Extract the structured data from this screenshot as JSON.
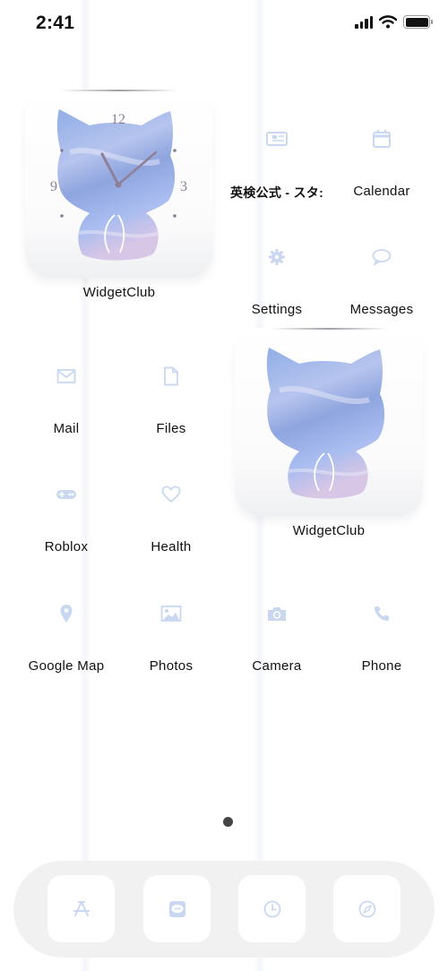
{
  "status_bar": {
    "time": "2:41",
    "signal_icon": "cellular-signal-icon",
    "wifi_icon": "wifi-icon",
    "battery_icon": "battery-full-icon"
  },
  "colors": {
    "icon_tint": "#c9d8f0",
    "label": "#111111",
    "dock_bg": "#f1f1f2",
    "page_dot_active": "#444444"
  },
  "widgets": [
    {
      "label": "WidgetClub",
      "type": "clock",
      "icon": "cat-sky-clock-icon",
      "clock_numerals": [
        "12",
        "3",
        "9"
      ]
    },
    {
      "label": "WidgetClub",
      "type": "photo",
      "icon": "cat-sky-photo-icon"
    }
  ],
  "apps": [
    {
      "label": "英検公式 - スタ:",
      "icon": "news-card-icon"
    },
    {
      "label": "Calendar",
      "icon": "calendar-icon"
    },
    {
      "label": "Settings",
      "icon": "gear-icon"
    },
    {
      "label": "Messages",
      "icon": "speech-bubble-icon"
    },
    {
      "label": "Mail",
      "icon": "envelope-icon"
    },
    {
      "label": "Files",
      "icon": "document-icon"
    },
    {
      "label": "Roblox",
      "icon": "gamepad-icon"
    },
    {
      "label": "Health",
      "icon": "heart-icon"
    },
    {
      "label": "Google Map",
      "icon": "map-pin-icon"
    },
    {
      "label": "Photos",
      "icon": "image-icon"
    },
    {
      "label": "Camera",
      "icon": "camera-icon"
    },
    {
      "label": "Phone",
      "icon": "phone-icon"
    }
  ],
  "page_indicator": {
    "pages": 1,
    "current": 1
  },
  "dock": [
    {
      "name": "App Store",
      "icon": "app-store-icon"
    },
    {
      "name": "LINE",
      "icon": "line-chat-icon"
    },
    {
      "name": "Clock",
      "icon": "clock-icon"
    },
    {
      "name": "Safari",
      "icon": "compass-icon"
    }
  ]
}
